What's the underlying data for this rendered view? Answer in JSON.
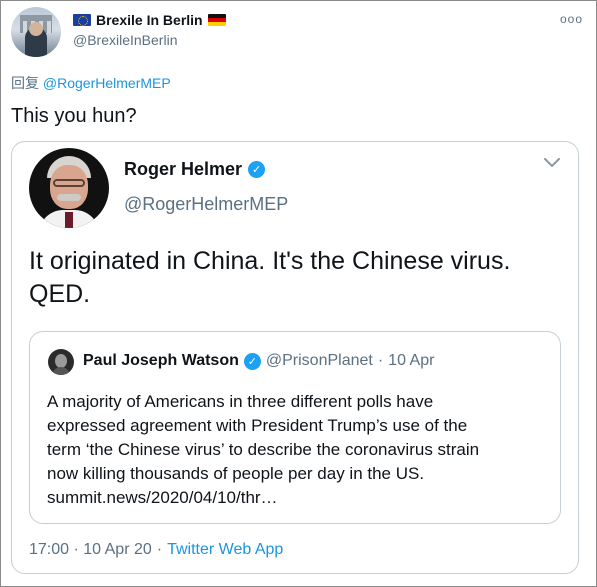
{
  "outer_tweet": {
    "display_name": "Brexile In Berlin",
    "handle": "@BrexileInBerlin",
    "more_label": "ooo",
    "reply_prefix": "回复",
    "reply_to": "@RogerHelmerMEP",
    "text": "This you hun?"
  },
  "embedded_tweet": {
    "display_name": "Roger Helmer",
    "handle": "@RogerHelmerMEP",
    "text_lines": [
      "It originated in China.  It's the Chinese virus.",
      "QED."
    ],
    "timestamp": "17:00 · 10 Apr 20",
    "separator": "·",
    "source": "Twitter Web App"
  },
  "quoted_tweet": {
    "display_name": "Paul Joseph Watson",
    "handle": "@PrisonPlanet",
    "separator": "·",
    "date": "10 Apr",
    "text_lines": [
      "A majority of Americans in three different polls have",
      "expressed agreement with President Trump’s use of the",
      "term ‘the Chinese virus’ to describe the coronavirus strain",
      "now killing thousands of people per day in the US.",
      "summit.news/2020/04/10/thr…"
    ]
  },
  "colors": {
    "link": "#1b95e0",
    "secondary_text": "#5b7083",
    "verified": "#1da1f2",
    "border": "#c4cfd6"
  },
  "icons": [
    "eu-flag-icon",
    "german-flag-icon",
    "more-options-icon",
    "verified-badge-icon",
    "chevron-down-icon"
  ]
}
